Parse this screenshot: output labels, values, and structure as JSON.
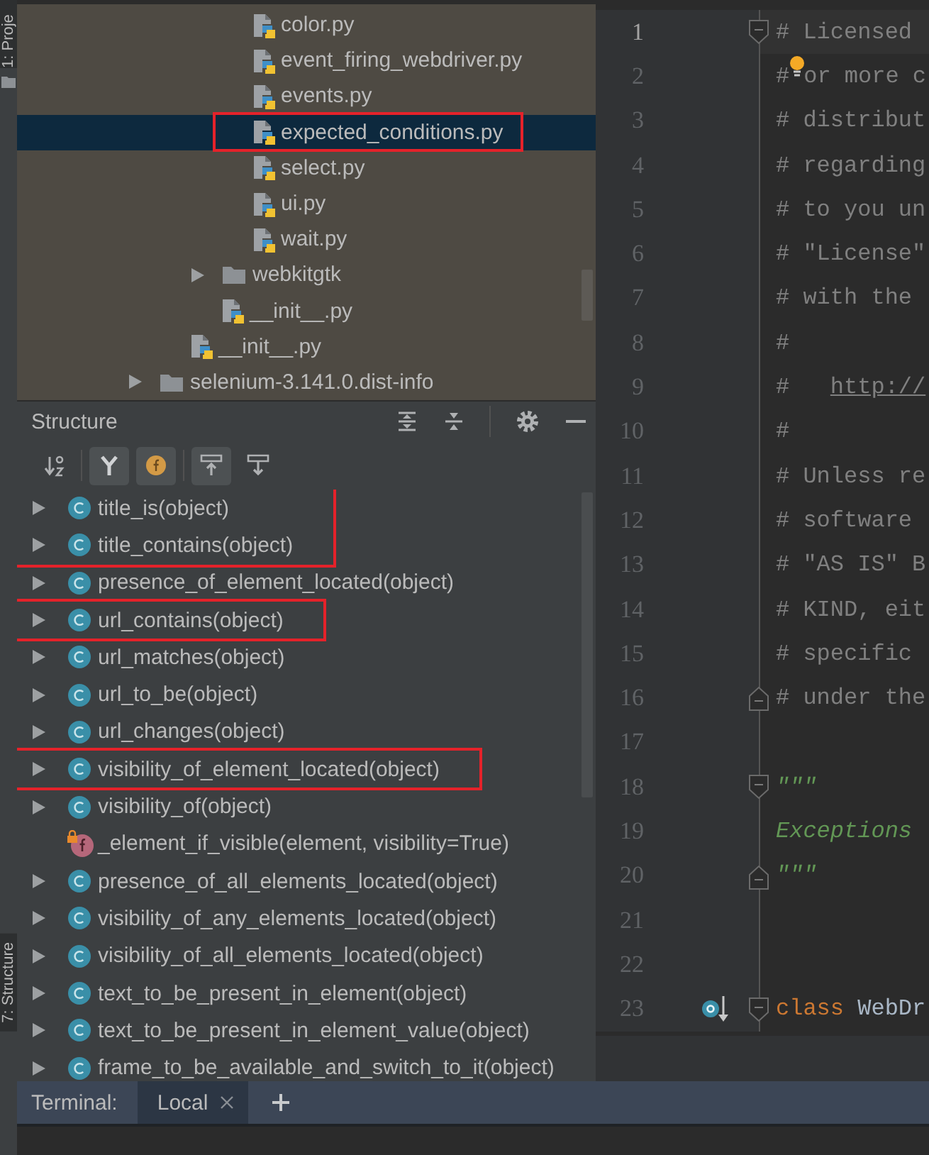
{
  "tool_stripe": {
    "tabs": [
      {
        "label": "1: Proje",
        "selected": true
      },
      {
        "label": "7: Structure",
        "selected": true
      }
    ]
  },
  "project_tree": {
    "items": [
      {
        "children": [
          {
            "children": [
              {
                "children": [
                  {
                    "name": "color.py",
                    "kind": "python",
                    "selected": false
                  },
                  {
                    "name": "event_firing_webdriver.py",
                    "kind": "python",
                    "selected": false
                  },
                  {
                    "name": "events.py",
                    "kind": "python",
                    "selected": false
                  },
                  {
                    "name": "expected_conditions.py",
                    "kind": "python",
                    "selected": true,
                    "highlighted": true
                  },
                  {
                    "name": "select.py",
                    "kind": "python",
                    "selected": false
                  },
                  {
                    "name": "ui.py",
                    "kind": "python",
                    "selected": false
                  },
                  {
                    "name": "wait.py",
                    "kind": "python",
                    "selected": false
                  }
                ]
              },
              {
                "name": "webkitgtk",
                "kind": "folder",
                "expanded": false,
                "selected": false
              },
              {
                "name": "__init__.py",
                "kind": "python",
                "selected": false
              }
            ]
          },
          {
            "name": "__init__.py",
            "kind": "python",
            "selected": false
          }
        ]
      },
      {
        "name": "selenium-3.141.0.dist-info",
        "kind": "folder",
        "expanded": false,
        "selected": false
      }
    ]
  },
  "structure": {
    "title": "Structure",
    "toolbar": [
      {
        "kind": "sort-alpha",
        "on": false
      },
      {
        "kind": "properties",
        "on": true
      },
      {
        "kind": "fields",
        "on": true
      },
      {
        "kind": "scroll-to-source",
        "on": true
      },
      {
        "kind": "scroll-from-source",
        "on": false
      }
    ],
    "items": [
      {
        "label": "title_is(object)",
        "kind": "class",
        "expandable": true,
        "highlighted": true
      },
      {
        "label": "title_contains(object)",
        "kind": "class",
        "expandable": true,
        "highlighted": true
      },
      {
        "label": "presence_of_element_located(object)",
        "kind": "class",
        "expandable": true
      },
      {
        "label": "url_contains(object)",
        "kind": "class",
        "expandable": true,
        "highlighted": true
      },
      {
        "label": "url_matches(object)",
        "kind": "class",
        "expandable": true
      },
      {
        "label": "url_to_be(object)",
        "kind": "class",
        "expandable": true
      },
      {
        "label": "url_changes(object)",
        "kind": "class",
        "expandable": true
      },
      {
        "label": "visibility_of_element_located(object)",
        "kind": "class",
        "expandable": true,
        "highlighted": true
      },
      {
        "label": "visibility_of(object)",
        "kind": "class",
        "expandable": true
      },
      {
        "label": "_element_if_visible(element, visibility=True)",
        "kind": "function",
        "expandable": false,
        "locked": true
      },
      {
        "label": "presence_of_all_elements_located(object)",
        "kind": "class",
        "expandable": true
      },
      {
        "label": "visibility_of_any_elements_located(object)",
        "kind": "class",
        "expandable": true
      },
      {
        "label": "visibility_of_all_elements_located(object)",
        "kind": "class",
        "expandable": true
      },
      {
        "label": "text_to_be_present_in_element(object)",
        "kind": "class",
        "expandable": true
      },
      {
        "label": "text_to_be_present_in_element_value(object)",
        "kind": "class",
        "expandable": true
      },
      {
        "label": "frame_to_be_available_and_switch_to_it(object)",
        "kind": "class",
        "expandable": true
      }
    ]
  },
  "editor": {
    "lines": [
      {
        "number": "1",
        "current": true,
        "fold_open": true,
        "tokens": [
          {
            "text": "# Licensed",
            "kind": "comment"
          }
        ]
      },
      {
        "number": "2",
        "bulb": true,
        "tokens": [
          {
            "text": "#",
            "kind": "comment"
          },
          {
            "text": "or more c",
            "kind": "comment"
          }
        ]
      },
      {
        "number": "3",
        "tokens": [
          {
            "text": "# distribut",
            "kind": "comment"
          }
        ]
      },
      {
        "number": "4",
        "tokens": [
          {
            "text": "# regarding",
            "kind": "comment"
          }
        ]
      },
      {
        "number": "5",
        "tokens": [
          {
            "text": "# to you un",
            "kind": "comment"
          }
        ]
      },
      {
        "number": "6",
        "tokens": [
          {
            "text": "# \"License\"",
            "kind": "comment"
          }
        ]
      },
      {
        "number": "7",
        "tokens": [
          {
            "text": "# with the",
            "kind": "comment"
          }
        ]
      },
      {
        "number": "8",
        "tokens": [
          {
            "text": "#",
            "kind": "comment"
          }
        ]
      },
      {
        "number": "9",
        "tokens": [
          {
            "text": "#   ",
            "kind": "comment"
          },
          {
            "text": "http://",
            "kind": "link"
          }
        ]
      },
      {
        "number": "10",
        "tokens": [
          {
            "text": "#",
            "kind": "comment"
          }
        ]
      },
      {
        "number": "11",
        "tokens": [
          {
            "text": "# Unless re",
            "kind": "comment"
          }
        ]
      },
      {
        "number": "12",
        "tokens": [
          {
            "text": "# software",
            "kind": "comment"
          }
        ]
      },
      {
        "number": "13",
        "tokens": [
          {
            "text": "# \"AS IS\" B",
            "kind": "comment"
          }
        ]
      },
      {
        "number": "14",
        "tokens": [
          {
            "text": "# KIND, eit",
            "kind": "comment"
          }
        ]
      },
      {
        "number": "15",
        "tokens": [
          {
            "text": "# specific",
            "kind": "comment"
          }
        ]
      },
      {
        "number": "16",
        "fold_close": true,
        "tokens": [
          {
            "text": "# under the",
            "kind": "comment"
          }
        ]
      },
      {
        "number": "17"
      },
      {
        "number": "18",
        "fold_open": true,
        "tokens": [
          {
            "text": "\"\"\"",
            "kind": "doc"
          }
        ]
      },
      {
        "number": "19",
        "tokens": [
          {
            "text": "Exceptions",
            "kind": "doc"
          }
        ]
      },
      {
        "number": "20",
        "fold_close": true,
        "tokens": [
          {
            "text": "\"\"\"",
            "kind": "doc"
          }
        ]
      },
      {
        "number": "21"
      },
      {
        "number": "22"
      },
      {
        "number": "23",
        "implemented": true,
        "fold_open": true,
        "tokens": [
          {
            "text": "class",
            "kind": "keyword"
          },
          {
            "text": " WebDr",
            "kind": "name"
          }
        ]
      }
    ]
  },
  "terminal": {
    "label": "Terminal:",
    "tabs": [
      {
        "label": "Local",
        "selected": true
      }
    ]
  }
}
